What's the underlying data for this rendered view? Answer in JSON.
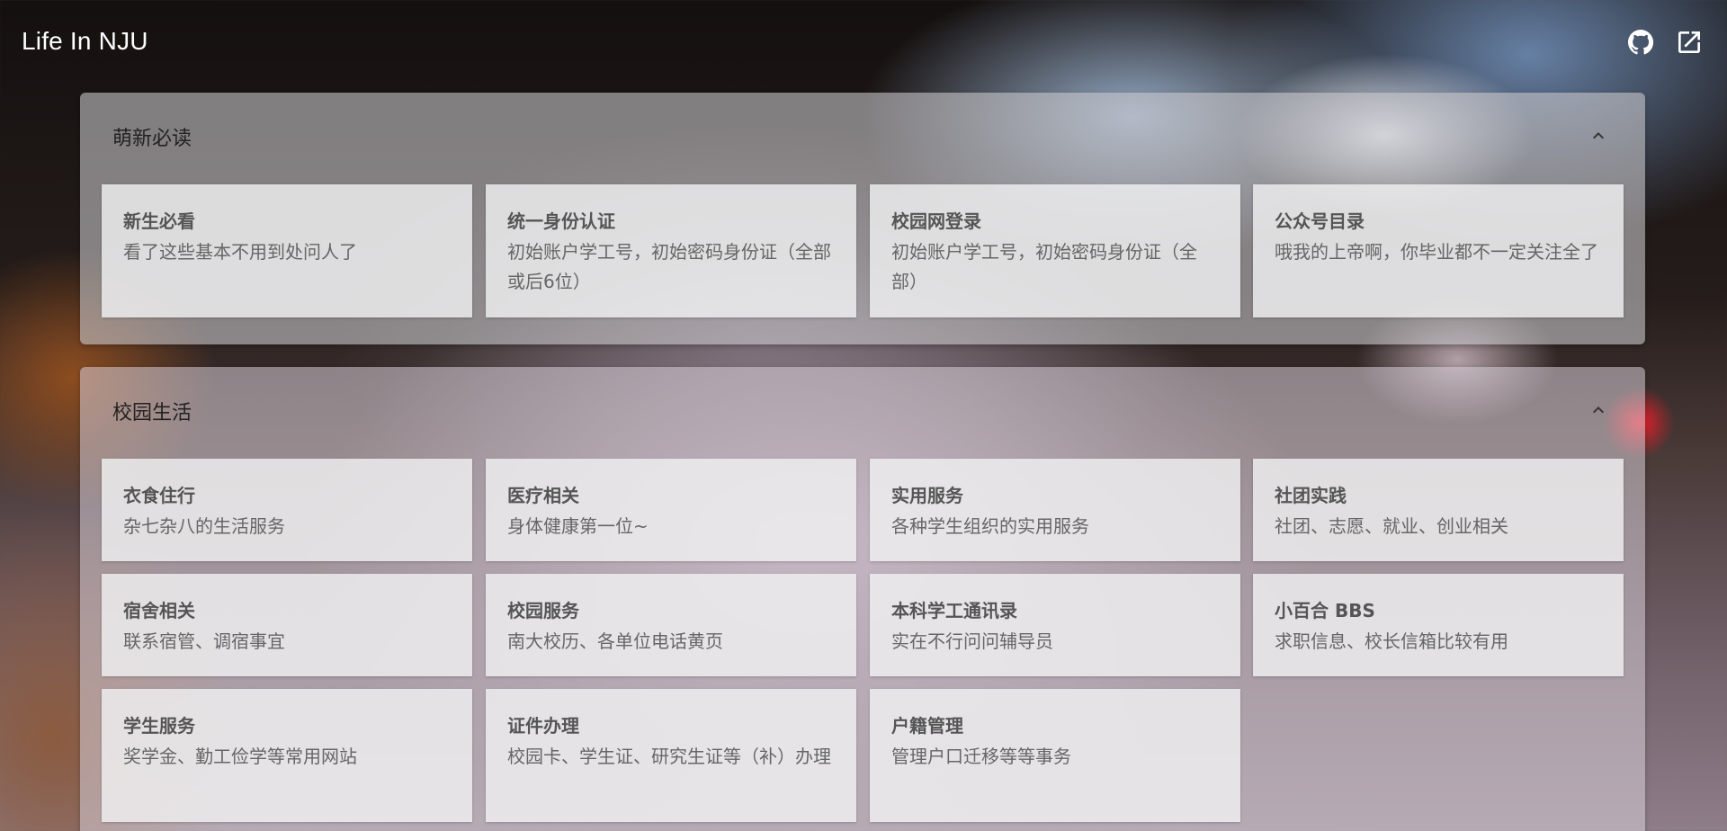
{
  "header": {
    "title": "Life In NJU",
    "icons": [
      "github-icon",
      "external-link-icon"
    ]
  },
  "sections": [
    {
      "title": "萌新必读",
      "cards": [
        {
          "title": "新生必看",
          "desc": "看了这些基本不用到处问人了"
        },
        {
          "title": "统一身份认证",
          "desc": "初始账户学工号，初始密码身份证（全部或后6位）"
        },
        {
          "title": "校园网登录",
          "desc": "初始账户学工号，初始密码身份证（全部）"
        },
        {
          "title": "公众号目录",
          "desc": "哦我的上帝啊，你毕业都不一定关注全了"
        }
      ]
    },
    {
      "title": "校园生活",
      "cards": [
        {
          "title": "衣食住行",
          "desc": "杂七杂八的生活服务"
        },
        {
          "title": "医疗相关",
          "desc": "身体健康第一位~"
        },
        {
          "title": "实用服务",
          "desc": "各种学生组织的实用服务"
        },
        {
          "title": "社团实践",
          "desc": "社团、志愿、就业、创业相关"
        },
        {
          "title": "宿舍相关",
          "desc": "联系宿管、调宿事宜"
        },
        {
          "title": "校园服务",
          "desc": "南大校历、各单位电话黄页"
        },
        {
          "title": "本科学工通讯录",
          "desc": "实在不行问问辅导员"
        },
        {
          "title": "小百合 BBS",
          "desc": "求职信息、校长信箱比较有用"
        },
        {
          "title": "学生服务",
          "desc": "奖学金、勤工俭学等常用网站"
        },
        {
          "title": "证件办理",
          "desc": "校园卡、学生证、研究生证等（补）办理"
        },
        {
          "title": "户籍管理",
          "desc": "管理户口迁移等等事务"
        }
      ]
    }
  ]
}
